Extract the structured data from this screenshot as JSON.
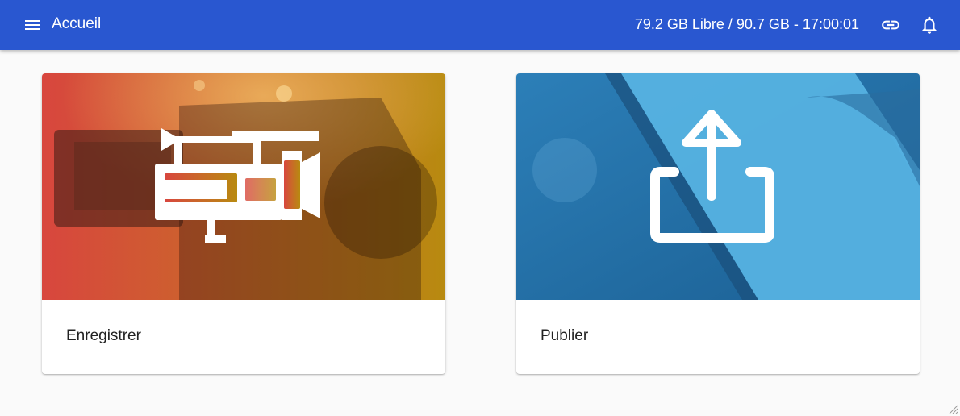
{
  "header": {
    "menu_icon": "menu-icon",
    "title": "Accueil",
    "storage_status": "79.2 GB Libre / 90.7 GB - 17:00:01",
    "link_icon": "link-icon",
    "bell_icon": "bell-icon",
    "background_color": "#2957d0"
  },
  "cards": [
    {
      "label": "Enregistrer",
      "icon": "video-camera-icon",
      "tint": [
        "#d9483a",
        "#b98a12"
      ]
    },
    {
      "label": "Publier",
      "icon": "upload-icon",
      "tint": [
        "#2f8fc8",
        "#1f6fa8"
      ]
    }
  ]
}
